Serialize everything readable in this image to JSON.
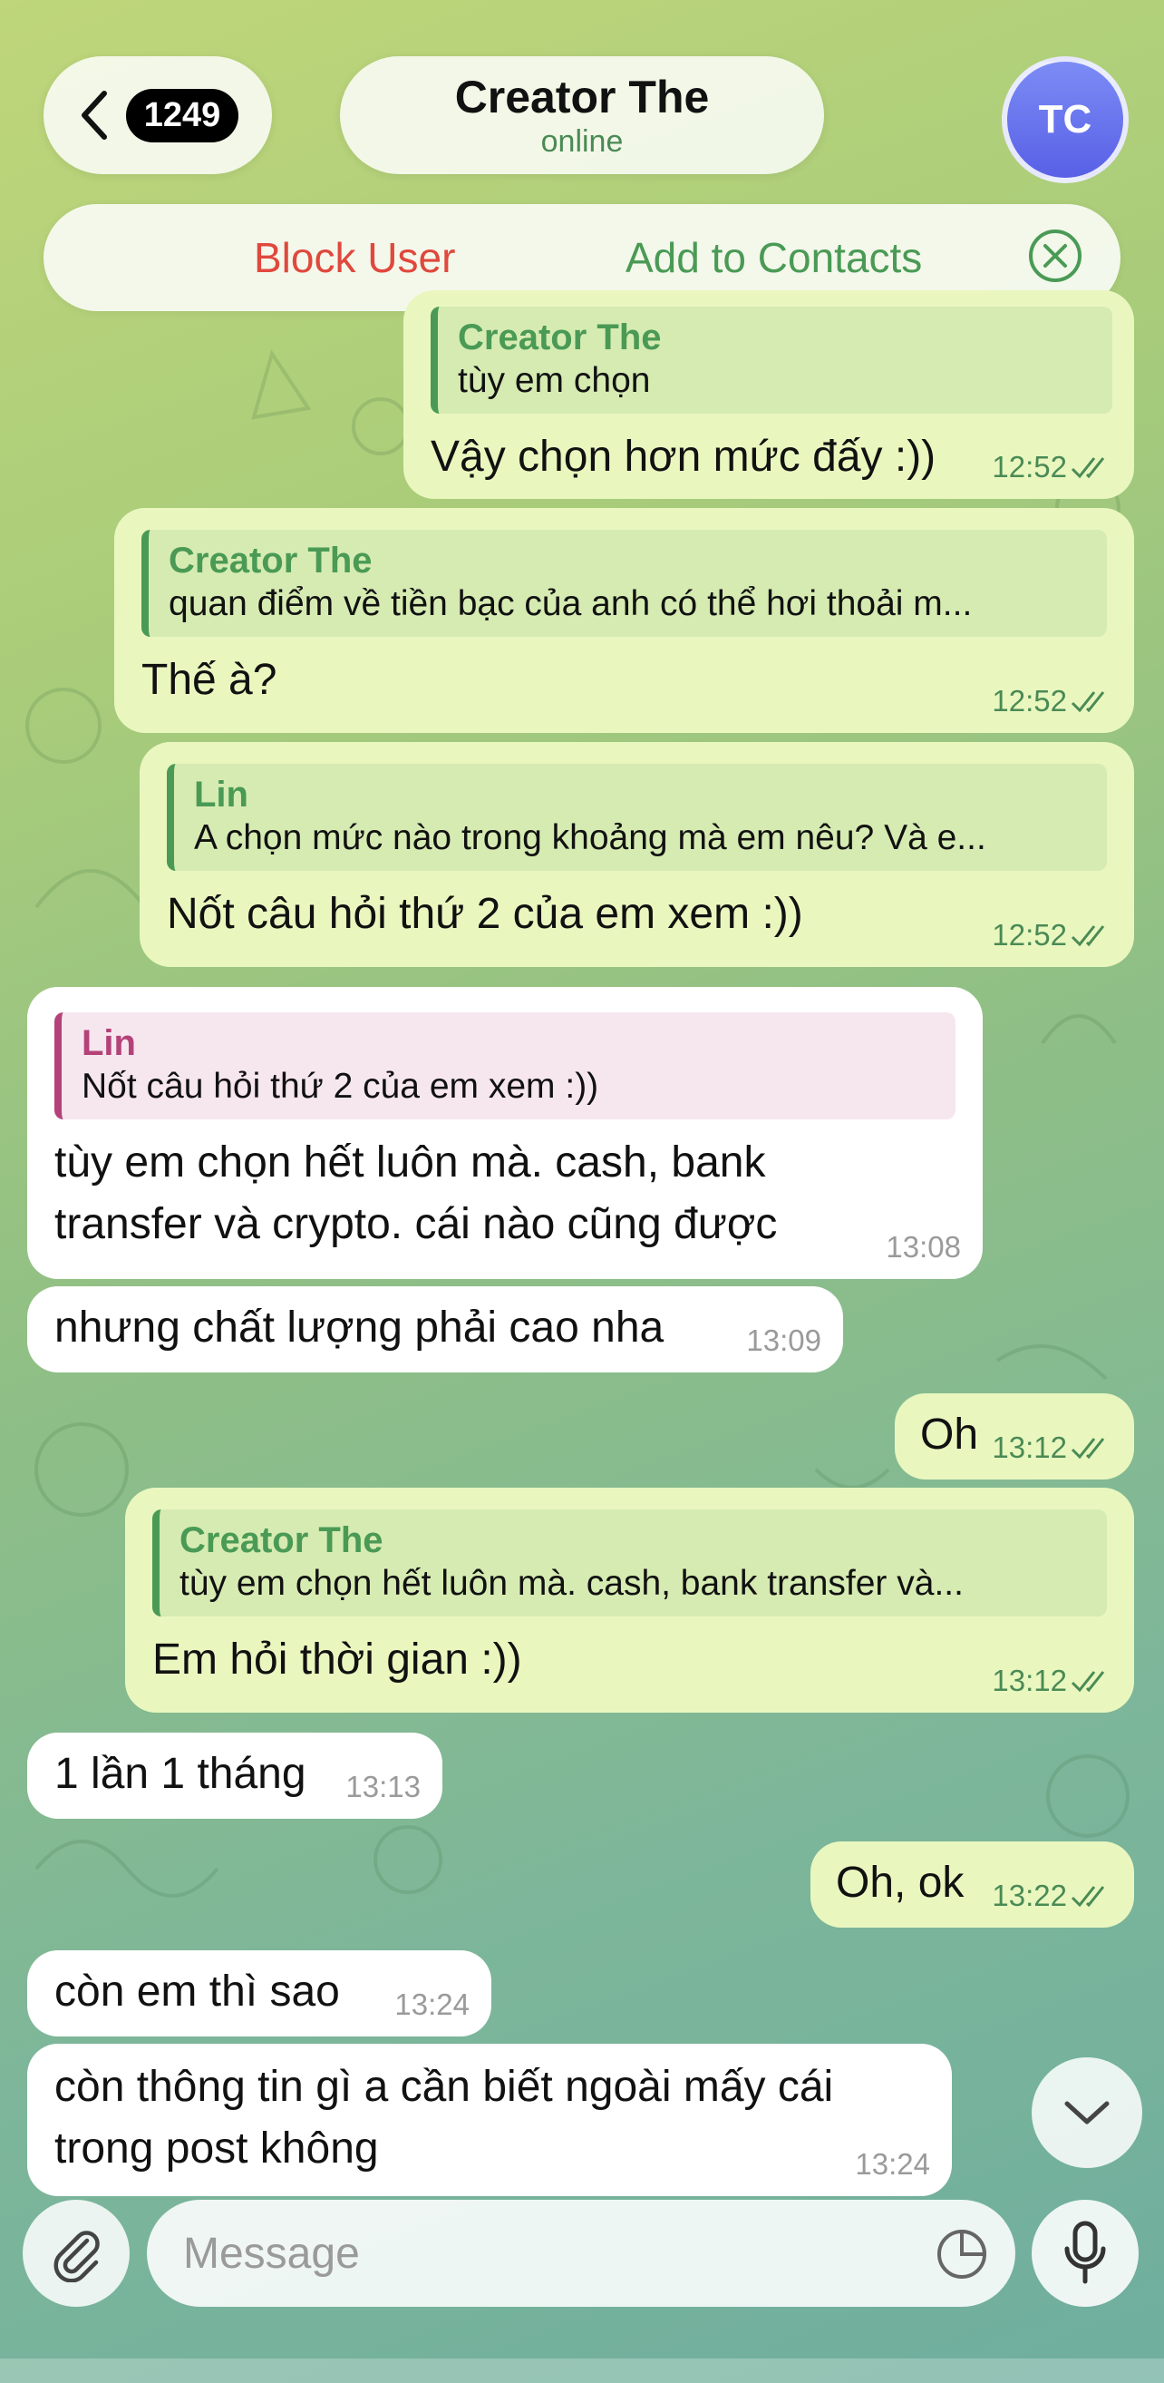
{
  "header": {
    "back_count": "1249",
    "title": "Creator The",
    "status": "online",
    "avatar_initials": "TC"
  },
  "actions": {
    "block_user": "Block User",
    "add_to_contacts": "Add to Contacts"
  },
  "messages": [
    {
      "dir": "out",
      "reply_name": "Creator The",
      "reply_text": "tùy em chọn",
      "text": "Vậy chọn hơn mức đấy :))",
      "time": "12:52"
    },
    {
      "dir": "out",
      "reply_name": "Creator The",
      "reply_text": "quan điểm về tiền bạc của anh có thể hơi thoải m...",
      "text": "Thế à?",
      "time": "12:52"
    },
    {
      "dir": "out",
      "reply_name": "Lin",
      "reply_text": "A chọn mức nào trong khoảng mà em nêu? Và e...",
      "text": "Nốt câu hỏi thứ 2 của em xem :))",
      "time": "12:52"
    },
    {
      "dir": "in",
      "reply_name": "Lin",
      "reply_text": "Nốt câu hỏi thứ 2 của em xem :))",
      "text_line1": "tùy em chọn hết luôn mà. cash, bank",
      "text_line2": "transfer và crypto. cái nào cũng được",
      "time": "13:08"
    },
    {
      "dir": "in",
      "text": "nhưng chất lượng phải cao nha",
      "time": "13:09"
    },
    {
      "dir": "out",
      "text": "Oh",
      "time": "13:12"
    },
    {
      "dir": "out",
      "reply_name": "Creator The",
      "reply_text": "tùy em chọn hết luôn mà. cash, bank transfer và...",
      "text": "Em hỏi thời gian :))",
      "time": "13:12"
    },
    {
      "dir": "in",
      "text": "1 lần 1 tháng",
      "time": "13:13"
    },
    {
      "dir": "out",
      "text": "Oh, ok",
      "time": "13:22"
    },
    {
      "dir": "in",
      "text": "còn em thì sao",
      "time": "13:24"
    },
    {
      "dir": "in",
      "text_line1": "còn thông tin gì a cần biết ngoài mấy cái",
      "text_line2": "trong post không",
      "time": "13:24"
    }
  ],
  "composer": {
    "placeholder": "Message"
  },
  "colors": {
    "outgoing_bubble": "#e9f7bf",
    "incoming_bubble": "#ffffff",
    "accent_green": "#4a9a55",
    "danger_red": "#e0483d",
    "reply_pink": "#b44279",
    "avatar": "#6a74ee"
  },
  "icons": [
    "chevron-left-icon",
    "close-circle-icon",
    "double-check-icon",
    "paperclip-icon",
    "sticker-icon",
    "microphone-icon",
    "chevron-down-icon"
  ]
}
